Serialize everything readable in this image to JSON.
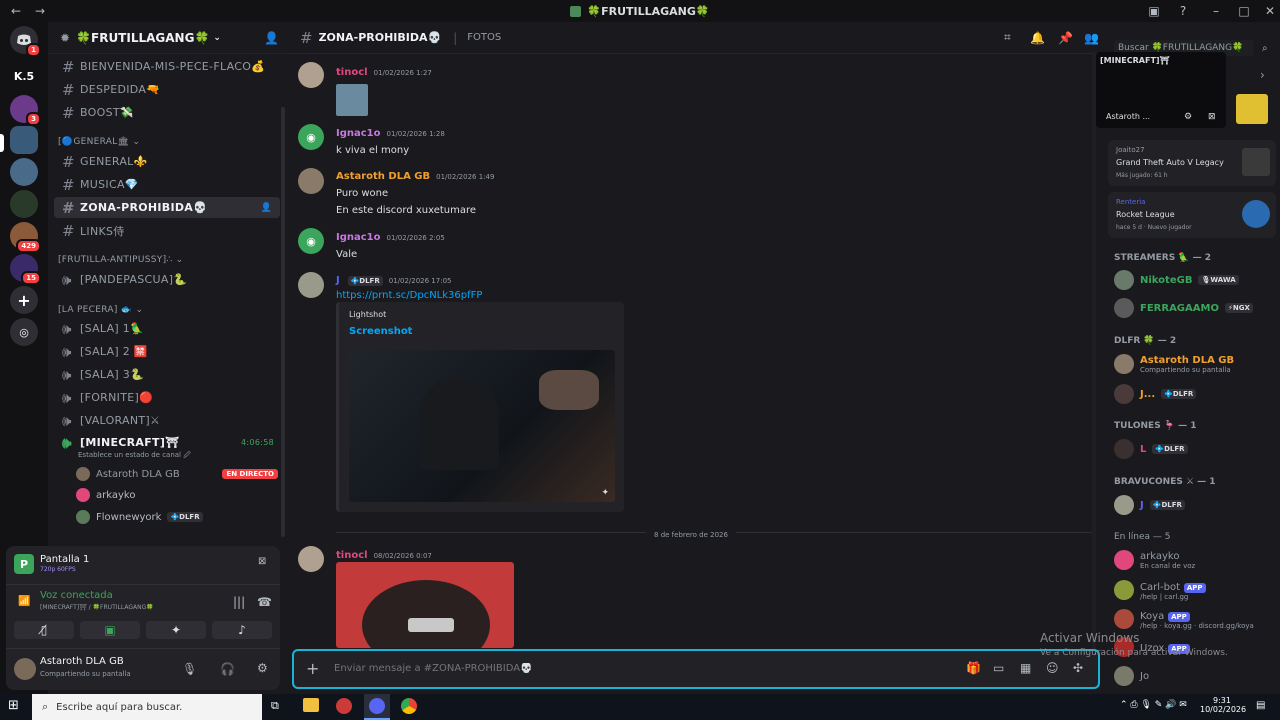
{
  "window": {
    "title": "🍀FRUTILLAGANG🍀"
  },
  "guilds": [
    {
      "label": "",
      "badge": "1",
      "color": "#5865f2"
    },
    {
      "label": "K.5",
      "badge": "",
      "color": "#121214"
    },
    {
      "label": "",
      "badge": "3",
      "color": "#6b3a8a"
    },
    {
      "label": "",
      "badge": "",
      "color": "#3a5a7a"
    },
    {
      "label": "",
      "badge": "",
      "color": "#4a6a8a"
    },
    {
      "label": "",
      "badge": "",
      "color": "#2a3a2a"
    },
    {
      "label": "",
      "badge": "429",
      "color": "#8a5a3a"
    },
    {
      "label": "",
      "badge": "15",
      "color": "#3a2a6a"
    }
  ],
  "server": {
    "name": "🍀FRUTILLAGANG🍀"
  },
  "channels": {
    "top": [
      "BIENVENIDA-MIS-PECE-FLACO💰",
      "DESPEDIDA🔫",
      "BOOST💸"
    ],
    "cat_general": "[🔵GENERAL🏛",
    "general": [
      "GENERAL⚜️",
      "MUSICA💎"
    ],
    "selected": "ZONA-PROHIBIDA💀",
    "links": "LINKS侍",
    "cat_antipussy": "[FRUTILLA-ANTIPUSSY]∴",
    "pandepascua": "[PANDEPASCUA]🐍",
    "cat_pecera": "[LA PECERA] 🐟",
    "voice": [
      "[SALA] 1🦜",
      "[SALA] 2 🈲",
      "[SALA] 3🐍",
      "[FORNITE]🔴",
      "[VALORANT]⚔"
    ],
    "minecraft": "[MINECRAFT]⛩",
    "minecraft_time": "4:06:58",
    "minecraft_status": "Establece un estado de canal 🖉",
    "voice_users": [
      {
        "name": "Astaroth DLA GB",
        "live": "EN DIRECTO",
        "tag": ""
      },
      {
        "name": "arkayko",
        "live": "",
        "tag": ""
      },
      {
        "name": "Flownewyork",
        "live": "",
        "tag": "💠DLFR"
      }
    ]
  },
  "stream_panel": {
    "title": "Pantalla 1",
    "quality": "720p 60FPS",
    "voice_status": "Voz conectada",
    "voice_channel": "[MINECRAFT]⛩ / 🍀FRUTILLAGANG🍀"
  },
  "user": {
    "name": "Astaroth DLA GB",
    "status": "Compartiendo su pantalla"
  },
  "header": {
    "channel": "ZONA-PROHIBIDA💀",
    "tab": "FOTOS",
    "search_placeholder": "Buscar 🍀FRUTILLAGANG🍀"
  },
  "messages": [
    {
      "name": "tinocl",
      "time": "01/02/2026 1:27",
      "color": "#e0487c",
      "text": ""
    },
    {
      "name": "Ignac1o",
      "time": "01/02/2026 1:28",
      "color": "#c678dd",
      "text": "k viva el mony"
    },
    {
      "name": "Astaroth DLA GB",
      "time": "01/02/2026 1:49",
      "color": "#f0a030",
      "text": "Puro wone",
      "text2": "En este discord xuxetumare"
    },
    {
      "name": "Ignac1o",
      "time": "01/02/2026 2:05",
      "color": "#c678dd",
      "text": "Vale"
    },
    {
      "name": "J",
      "time": "01/02/2026 17:05",
      "color": "#5865f2",
      "tag": "💠DLFR",
      "link": "https://prnt.sc/DpcNLk36pfFP",
      "embed_provider": "Lightshot",
      "embed_title": "Screenshot"
    },
    {
      "name": "tinocl",
      "time": "08/02/2026 0:07",
      "color": "#e0487c",
      "text": ""
    }
  ],
  "date_divider": "8 de febrero de 2026",
  "composer": {
    "placeholder": "Enviar mensaje a #ZONA-PROHIBIDA💀"
  },
  "watermark": {
    "line1": "Activar Windows",
    "line2": "Ve a Configuración para activar Windows."
  },
  "members_panel": {
    "stream_title": "[MINECRAFT]⛩",
    "stream_user": "Astaroth ...",
    "activities": [
      {
        "name": "Joaito27",
        "game": "Grand Theft Auto V Legacy",
        "detail": "Más jugado: 61 h"
      },
      {
        "name": "Renteria",
        "game": "Rocket League",
        "detail": "hace 5 d · Nuevo jugador"
      }
    ],
    "groups": [
      {
        "title": "STREAMERS 🦜 — 2",
        "members": [
          {
            "name": "NikoteGB",
            "color": "#3ba55c",
            "tag": "🎙WAWA",
            "sub": ""
          },
          {
            "name": "FERRAGAAMO",
            "color": "#3ba55c",
            "tag": "⚡NGX",
            "sub": ""
          }
        ]
      },
      {
        "title": "DLFR 🍀 — 2",
        "members": [
          {
            "name": "Astaroth DLA GB",
            "color": "#f0a030",
            "tag": "",
            "sub": "Compartiendo su pantalla"
          },
          {
            "name": "J...",
            "color": "#f0a030",
            "tag": "💠DLFR",
            "sub": ""
          }
        ]
      },
      {
        "title": "TULONES 🦩 — 1",
        "members": [
          {
            "name": "L",
            "color": "#e0487c",
            "tag": "💠DLFR",
            "sub": ""
          }
        ]
      },
      {
        "title": "BRAVUCONES ⚔ — 1",
        "members": [
          {
            "name": "J",
            "color": "#5865f2",
            "tag": "💠DLFR",
            "sub": ""
          }
        ]
      },
      {
        "title": "En línea — 5",
        "members": [
          {
            "name": "arkayko",
            "color": "#949ba4",
            "tag": "",
            "sub": "En canal de voz"
          },
          {
            "name": "Carl-bot",
            "color": "#949ba4",
            "tag": "APP",
            "sub": "/help | carl.gg"
          },
          {
            "name": "Koya",
            "color": "#949ba4",
            "tag": "APP",
            "sub": "/help · koya.gg · discord.gg/koya"
          },
          {
            "name": "Uzox",
            "color": "#949ba4",
            "tag": "APP",
            "sub": ""
          },
          {
            "name": "Jo",
            "color": "#949ba4",
            "tag": "",
            "sub": ""
          }
        ]
      }
    ]
  },
  "taskbar": {
    "search_placeholder": "Escribe aquí para buscar.",
    "time": "9:31",
    "date": "10/02/2026"
  }
}
